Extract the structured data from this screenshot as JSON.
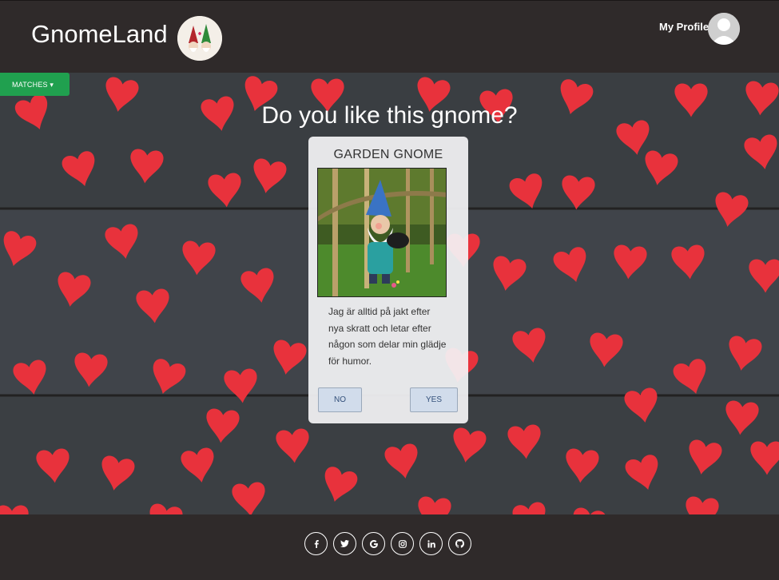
{
  "header": {
    "brand": "GnomeLand",
    "profile_label": "My Profile"
  },
  "matches_button": {
    "label": "MATCHES ▾"
  },
  "main": {
    "headline": "Do you like this gnome?"
  },
  "card": {
    "title": "GARDEN GNOME",
    "description": "Jag är alltid på jakt efter nya skratt och letar efter någon som delar min glädje för humor.",
    "no_label": "NO",
    "yes_label": "YES"
  },
  "footer": {
    "social_icons": [
      "facebook-icon",
      "twitter-icon",
      "google-icon",
      "instagram-icon",
      "linkedin-icon",
      "github-icon"
    ]
  },
  "colors": {
    "header_bg": "#2f2a2a",
    "matches_green": "#20a04f",
    "heart_red": "#e8323c",
    "button_blue": "#d1dceb"
  }
}
